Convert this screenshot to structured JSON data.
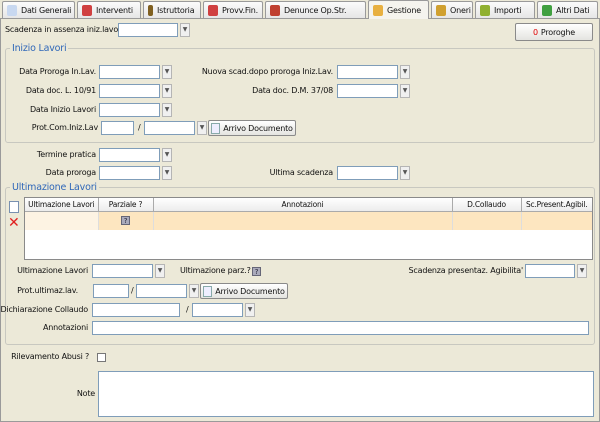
{
  "tabs": [
    {
      "label": "Dati Generali",
      "icon": "document-icon",
      "color": "#c8d8f0"
    },
    {
      "label": "Interventi",
      "icon": "heart-icon",
      "color": "#d04040"
    },
    {
      "label": "Istruttoria",
      "icon": "traffic-light-icon",
      "color": "#806020"
    },
    {
      "label": "Provv.Fin.",
      "icon": "pdf-icon",
      "color": "#d04040"
    },
    {
      "label": "Denunce Op.Str.",
      "icon": "structure-icon",
      "color": "#c04030"
    },
    {
      "label": "Gestione",
      "icon": "user-icon",
      "color": "#e8b040"
    },
    {
      "label": "Oneri",
      "icon": "money-bag-icon",
      "color": "#d0a030"
    },
    {
      "label": "Importi",
      "icon": "coins-icon",
      "color": "#90b030"
    },
    {
      "label": "Altri Dati",
      "icon": "data-icon",
      "color": "#40a040"
    }
  ],
  "top": {
    "scadenza_label": "Scadenza in assenza iniz.lavori",
    "proroghe_count": "0",
    "proroghe_label": "Proroghe"
  },
  "inizio": {
    "legend": "Inizio Lavori",
    "data_proroga": "Data Proroga In.Lav.",
    "nuova_scad": "Nuova scad.dopo proroga Iniz.Lav.",
    "data_doc_l": "Data doc. L. 10/91",
    "data_doc_dm": "Data doc. D.M. 37/08",
    "data_inizio": "Data Inizio Lavori",
    "prot": "Prot.Com.Iniz.Lav",
    "slash": "/",
    "arrivo": "Arrivo Documento"
  },
  "termine": {
    "termine_pratica": "Termine pratica",
    "data_proroga": "Data proroga",
    "ultima_scadenza": "Ultima scadenza"
  },
  "ultimazione": {
    "legend": "Ultimazione Lavori",
    "columns": [
      "Ultimazione Lavori",
      "Parziale ?",
      "Annotazioni",
      "D.Collaudo",
      "Sc.Present.Agibil."
    ],
    "check_glyph": "?",
    "ult_lavori": "Ultimazione Lavori",
    "ult_parz": "Ultimazione parz.?",
    "scad_agib": "Scadenza presentaz. Agibilita'",
    "prot": "Prot.ultimaz.lav.",
    "slash": "/",
    "arrivo": "Arrivo Documento",
    "dich_collaudo": "Dichiarazione Collaudo",
    "annotazioni": "Annotazioni"
  },
  "bottom": {
    "rilevamento": "Rilevamento Abusi ?",
    "note": "Note"
  }
}
